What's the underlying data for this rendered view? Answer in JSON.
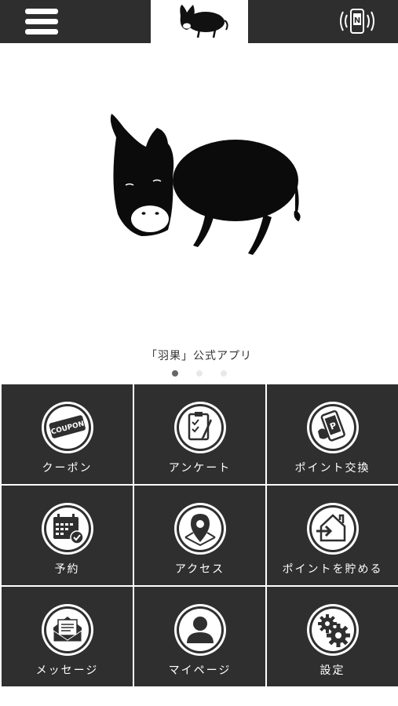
{
  "header": {
    "menu_icon": "hamburger-menu-icon",
    "logo_icon": "donkey-logo-icon",
    "nfc_icon": "nfc-phone-icon"
  },
  "hero": {
    "caption": "「羽果」公式アプリ",
    "slide_count": 3,
    "active_slide": 1
  },
  "menu": {
    "items": [
      {
        "label": "クーポン",
        "icon": "coupon-icon"
      },
      {
        "label": "アンケート",
        "icon": "survey-clipboard-icon"
      },
      {
        "label": "ポイント交換",
        "icon": "point-exchange-icon"
      },
      {
        "label": "予約",
        "icon": "calendar-reservation-icon"
      },
      {
        "label": "アクセス",
        "icon": "map-pin-icon"
      },
      {
        "label": "ポイントを貯める",
        "icon": "point-checkin-icon"
      },
      {
        "label": "メッセージ",
        "icon": "message-envelope-icon"
      },
      {
        "label": "マイページ",
        "icon": "user-profile-icon"
      },
      {
        "label": "設定",
        "icon": "settings-gears-icon"
      }
    ],
    "coupon_badge_text": "COUPON",
    "point_badge_text": "P"
  },
  "colors": {
    "header_bg": "#2e2e2e",
    "tile_bg": "#2f2f2f",
    "tile_text": "#ffffff",
    "dot_active": "#666666",
    "dot_inactive": "#e8e8e8"
  }
}
